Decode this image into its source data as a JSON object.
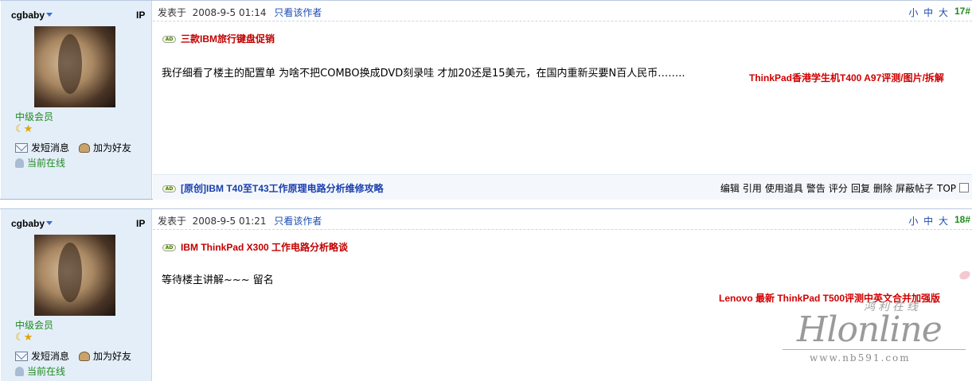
{
  "posts": [
    {
      "author": "cgbaby",
      "ip_label": "IP",
      "level": "中级会员",
      "actions": {
        "message": "发短消息",
        "add_friend": "加为好友",
        "online": "当前在线"
      },
      "meta": {
        "posted_label": "发表于",
        "time": "2008-9-5 01:14",
        "only_author": "只看该作者"
      },
      "size_controls": "小 中 大",
      "floor": "17#",
      "ad_top": "三款IBM旅行键盘促销",
      "content": "我仔细看了楼主的配置单  为啥不把COMBO换成DVD刻录哇  才加20还是15美元，在国内重新买要N百人民币……..",
      "promo": "ThinkPad香港学生机T400 A97评测/图片/拆解",
      "footer_ad": "[原创]IBM T40至T43工作原理电路分析维修攻略",
      "tools": [
        "编辑",
        "引用",
        "使用道具",
        "警告",
        "评分",
        "回复",
        "删除",
        "屏蔽帖子",
        "TOP"
      ]
    },
    {
      "author": "cgbaby",
      "ip_label": "IP",
      "level": "中级会员",
      "actions": {
        "message": "发短消息",
        "add_friend": "加为好友",
        "online": "当前在线"
      },
      "meta": {
        "posted_label": "发表于",
        "time": "2008-9-5 01:21",
        "only_author": "只看该作者"
      },
      "size_controls": "小 中 大",
      "floor": "18#",
      "ad_top": "IBM ThinkPad X300 工作电路分析略谈",
      "content": "等待楼主讲解~~~  留名",
      "promo": "Lenovo 最新  ThinkPad T500评测中英文合并加强版"
    }
  ],
  "watermark": {
    "logo_cn": "鸿利在线",
    "logo": "Hlonline",
    "url": "www.nb591.com"
  },
  "ad_badge": "AD"
}
